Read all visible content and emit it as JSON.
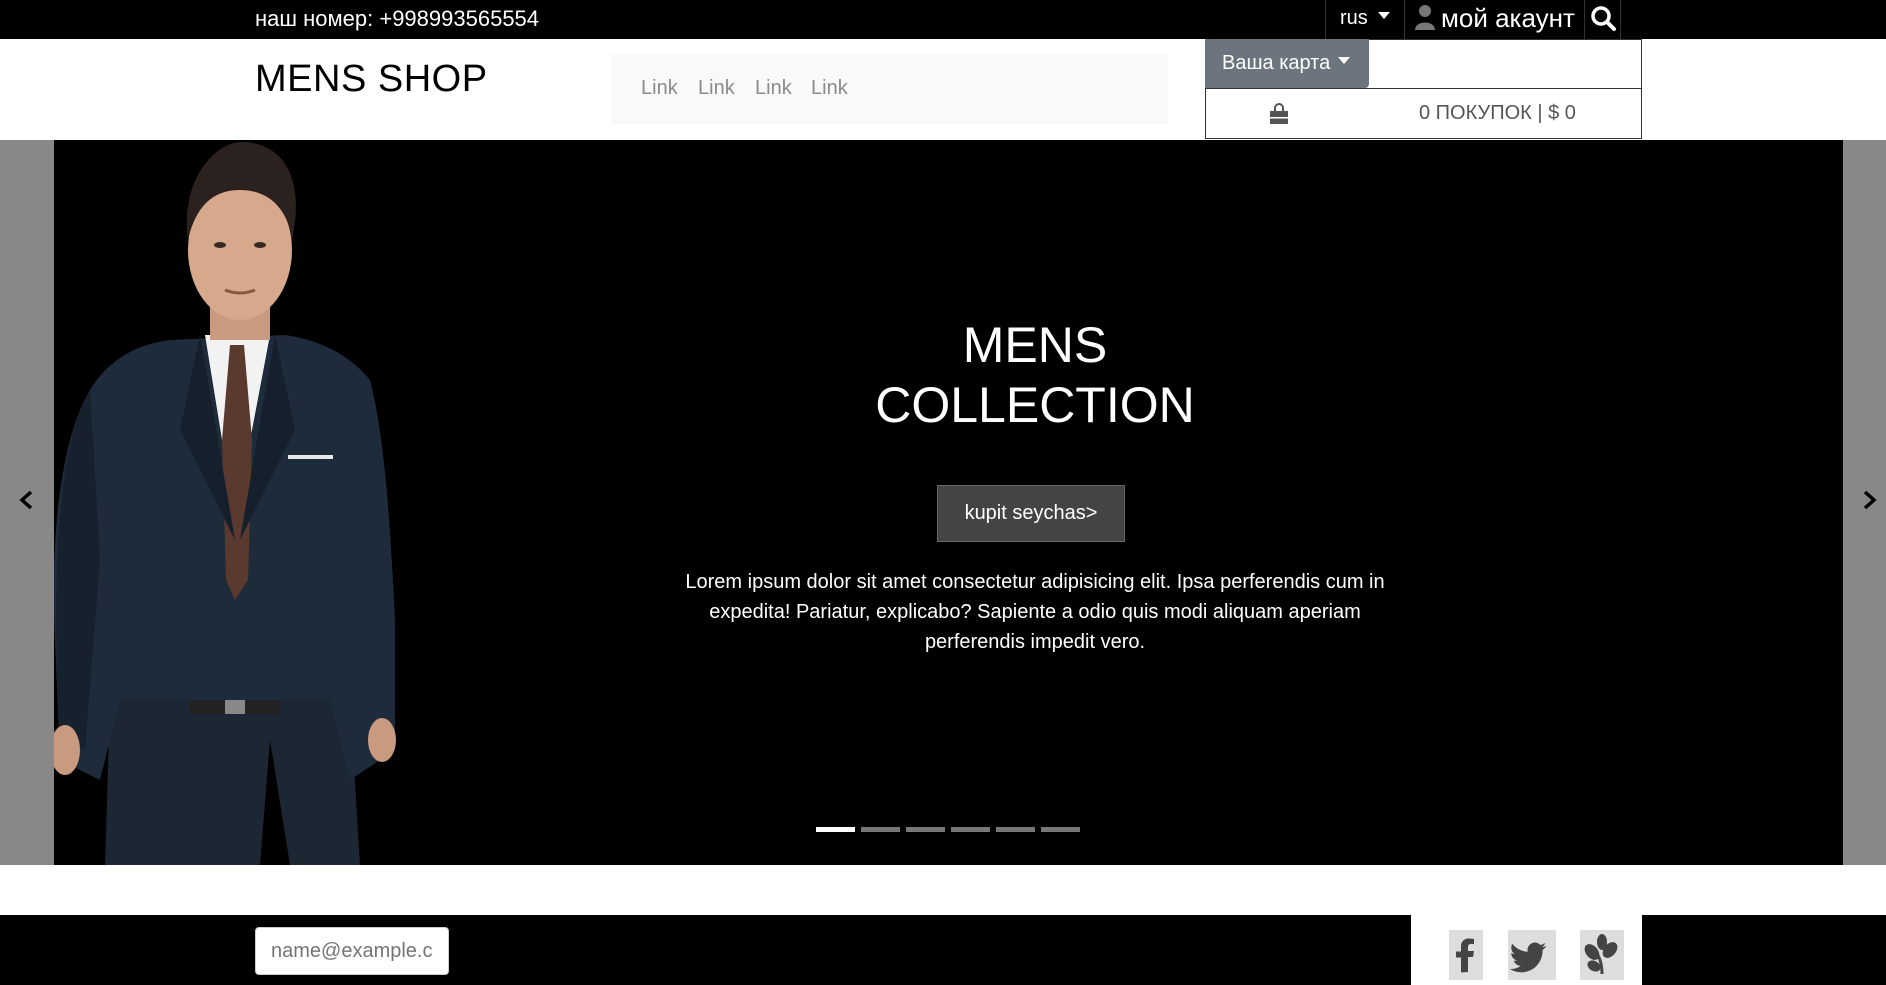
{
  "topbar": {
    "phone": "наш номер: +998993565554",
    "language": "rus",
    "account": "мой акаунт"
  },
  "header": {
    "logo": "MENS SHOP",
    "nav_links": [
      "Link",
      "Link",
      "Link",
      "Link"
    ],
    "cart_button": "Ваша карта",
    "cart_summary": "0 ПОКУПОК | $ 0"
  },
  "hero": {
    "title_line1": "MENS",
    "title_line2": "COLLECTION",
    "cta": "kupit seychas>",
    "text": "Lorem ipsum dolor sit amet consectetur adipisicing elit. Ipsa perferendis cum in expedita! Pariatur, explicabo? Sapiente a odio quis modi aliquam aperiam perferendis impedit vero.",
    "slide_count": 6,
    "active_slide": 0
  },
  "footer": {
    "email_placeholder": "name@example.com"
  },
  "icons": {
    "user": "user-icon",
    "search": "search-icon",
    "bag": "shopping-bag-icon",
    "prev": "chevron-left-icon",
    "next": "chevron-right-icon",
    "social": [
      "facebook-icon",
      "twitter-icon",
      "leaf-icon"
    ]
  },
  "colors": {
    "topbar": "#000000",
    "cart_button": "#6c757d",
    "nav_bg": "#f8f9fa",
    "cta_bg": "#444444"
  }
}
